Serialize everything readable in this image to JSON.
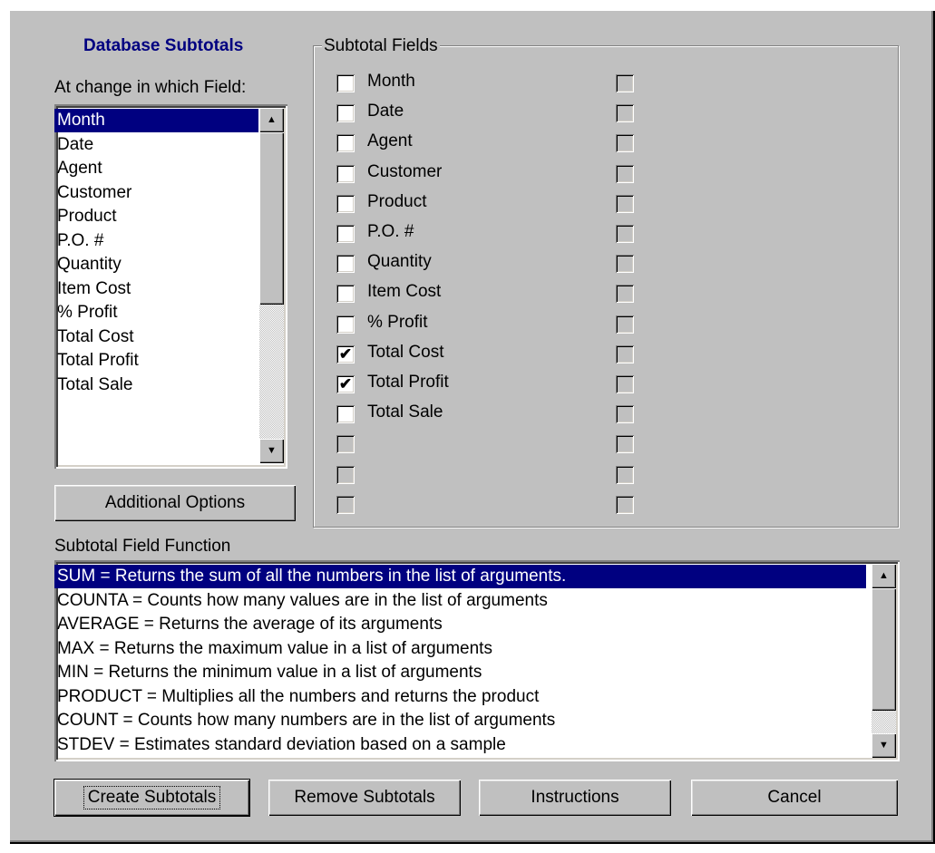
{
  "dialog": {
    "title": "Database Subtotals",
    "change_label": "At change in which Field:",
    "fields_list": {
      "selected_index": 0,
      "items": [
        "Month",
        "Date",
        "Agent",
        "Customer",
        "Product",
        "P.O. #",
        "Quantity",
        "Item Cost",
        "% Profit",
        "Total Cost",
        "Total Profit",
        "Total Sale"
      ]
    },
    "additional_options_label": "Additional Options",
    "subtotal_fields": {
      "legend": "Subtotal Fields",
      "left_column": [
        {
          "label": "Month",
          "checked": false
        },
        {
          "label": "Date",
          "checked": false
        },
        {
          "label": "Agent",
          "checked": false
        },
        {
          "label": "Customer",
          "checked": false
        },
        {
          "label": "Product",
          "checked": false
        },
        {
          "label": "P.O. #",
          "checked": false
        },
        {
          "label": "Quantity",
          "checked": false
        },
        {
          "label": "Item Cost",
          "checked": false
        },
        {
          "label": "% Profit",
          "checked": false
        },
        {
          "label": "Total Cost",
          "checked": true
        },
        {
          "label": "Total Profit",
          "checked": true
        },
        {
          "label": "Total Sale",
          "checked": false
        },
        {
          "label": "",
          "checked": false,
          "disabled": true
        },
        {
          "label": "",
          "checked": false,
          "disabled": true
        },
        {
          "label": "",
          "checked": false,
          "disabled": true
        }
      ],
      "right_column_count": 15
    },
    "function_label": "Subtotal Field Function",
    "functions_list": {
      "selected_index": 0,
      "items": [
        "SUM = Returns the sum of all the numbers in the list of arguments.",
        "COUNTA = Counts how many values are in the list of arguments",
        "AVERAGE = Returns the average of its arguments",
        "MAX = Returns the maximum value in a list of arguments",
        "MIN = Returns the minimum value in a list of arguments",
        "PRODUCT = Multiplies all the numbers and returns the product",
        "COUNT = Counts how many numbers are in the list of arguments",
        "STDEV = Estimates standard deviation based on a sample"
      ]
    },
    "buttons": {
      "create": "Create Subtotals",
      "remove": "Remove Subtotals",
      "instructions": "Instructions",
      "cancel": "Cancel"
    },
    "check_glyph": "✔"
  }
}
